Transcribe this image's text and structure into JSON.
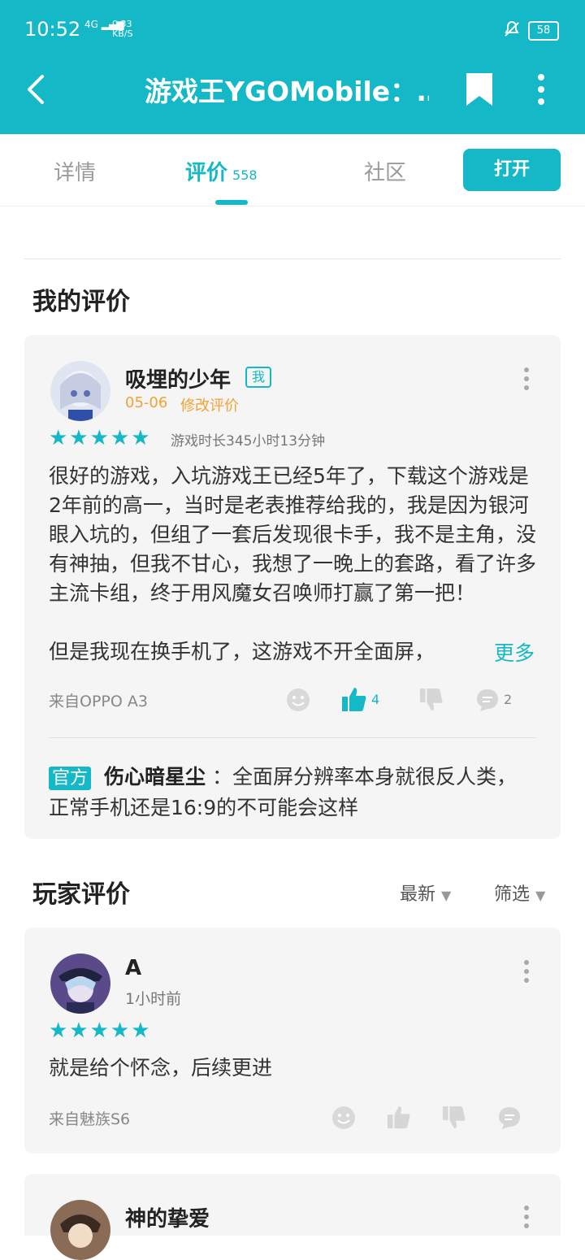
{
  "status": {
    "time": "10:52",
    "network": "4G",
    "speed_value": "0.33",
    "speed_unit": "KB/S",
    "battery": "58"
  },
  "header": {
    "title": "游戏王YGOMobile：…"
  },
  "tabs": {
    "details": "详情",
    "reviews": "评价",
    "reviews_count": "558",
    "community": "社区",
    "open_button": "打开"
  },
  "my_review": {
    "section_title": "我的评价",
    "username": "吸埋的少年",
    "me_badge": "我",
    "date": "05-06",
    "edit_link": "修改评价",
    "stars": "★★★★★",
    "playtime": "游戏时长345小时13分钟",
    "text": "很好的游戏，入坑游戏王已经5年了，下载这个游戏是2年前的高一，当时是老表推荐给我的，我是因为银河眼入坑的，但组了一套后发现很卡手，我不是主角，没有神抽，但我不甘心，我想了一晚上的套路，看了许多主流卡组，终于用风魔女召唤师打赢了第一把！",
    "text_tail": "但是我现在换手机了，这游戏不开全面屏，",
    "more": "更多",
    "source": "来自OPPO A3",
    "likes": "4",
    "comments": "2",
    "official_tag": "官方",
    "official_name": "伤心暗星尘",
    "official_reply": "：全面屏分辨率本身就很反人类，正常手机还是16:9的不可能会这样"
  },
  "player_reviews": {
    "section_title": "玩家评价",
    "sort_label": "最新",
    "filter_label": "筛选",
    "items": [
      {
        "username": "A",
        "time": "1小时前",
        "stars": "★★★★★",
        "text": "就是给个怀念，后续更进",
        "source": "来自魅族S6"
      },
      {
        "username": "神的挚爱"
      }
    ]
  },
  "colors": {
    "accent": "#15b8c6",
    "orange": "#f2a233"
  }
}
